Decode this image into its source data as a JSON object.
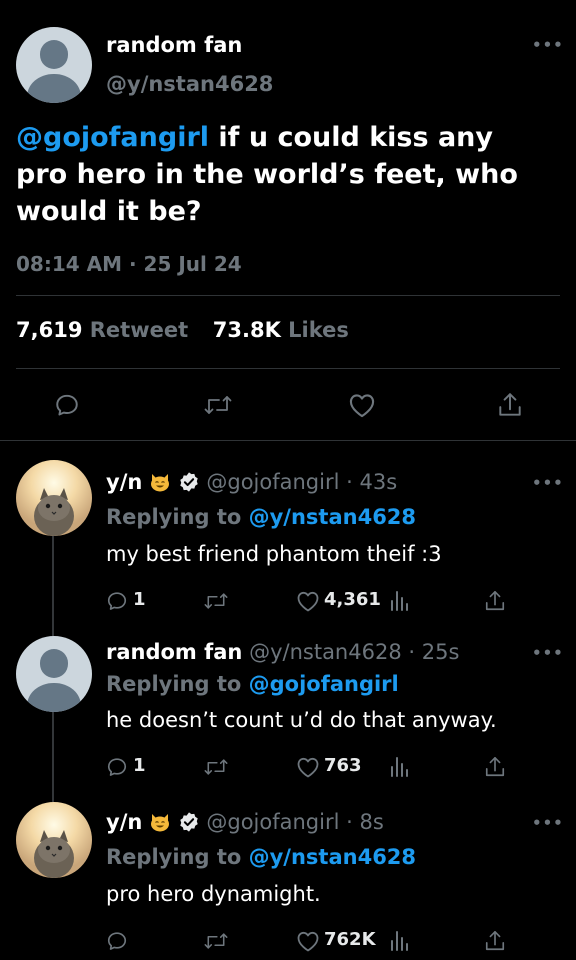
{
  "main_tweet": {
    "author_name": "random fan",
    "author_handle": "@y/nstan4628",
    "text_mention": "@gojofangirl",
    "text_line1": " if u could kiss any",
    "text_line2": "pro hero in the world’s feet, who",
    "text_line3": "would it be?",
    "timestamp": "08:14 AM · 25 Jul 24",
    "retweet_count": "7,619",
    "retweet_label": "Retweet",
    "like_count": "73.8K",
    "like_label": "Likes"
  },
  "replies": [
    {
      "author_name": "y/n",
      "author_handle": "@gojofangirl",
      "time": "· 43s",
      "replying_label": "Replying to",
      "replying_to": "@y/nstan4628",
      "text": "my best friend phantom theif :3",
      "reply_count": "1",
      "like_count": "4,361"
    },
    {
      "author_name": "random fan",
      "author_handle": "@y/nstan4628",
      "time": "· 25s",
      "replying_label": "Replying to",
      "replying_to": "@gojofangirl",
      "text": "he doesn’t count u’d do that anyway.",
      "reply_count": "1",
      "like_count": "763"
    },
    {
      "author_name": "y/n",
      "author_handle": "@gojofangirl",
      "time": "· 8s",
      "replying_label": "Replying to",
      "replying_to": "@y/nstan4628",
      "text": "pro hero dynamight.",
      "reply_count": "",
      "like_count": "762K"
    }
  ],
  "icons": [
    "more-icon",
    "reply-icon",
    "retweet-icon",
    "like-icon",
    "share-icon",
    "verified-icon",
    "cat-emoji-icon",
    "views-icon"
  ],
  "colors": {
    "background": "#000000",
    "accent": "#1d9bf0",
    "muted": "#6e767d",
    "divider": "#2f3336"
  }
}
